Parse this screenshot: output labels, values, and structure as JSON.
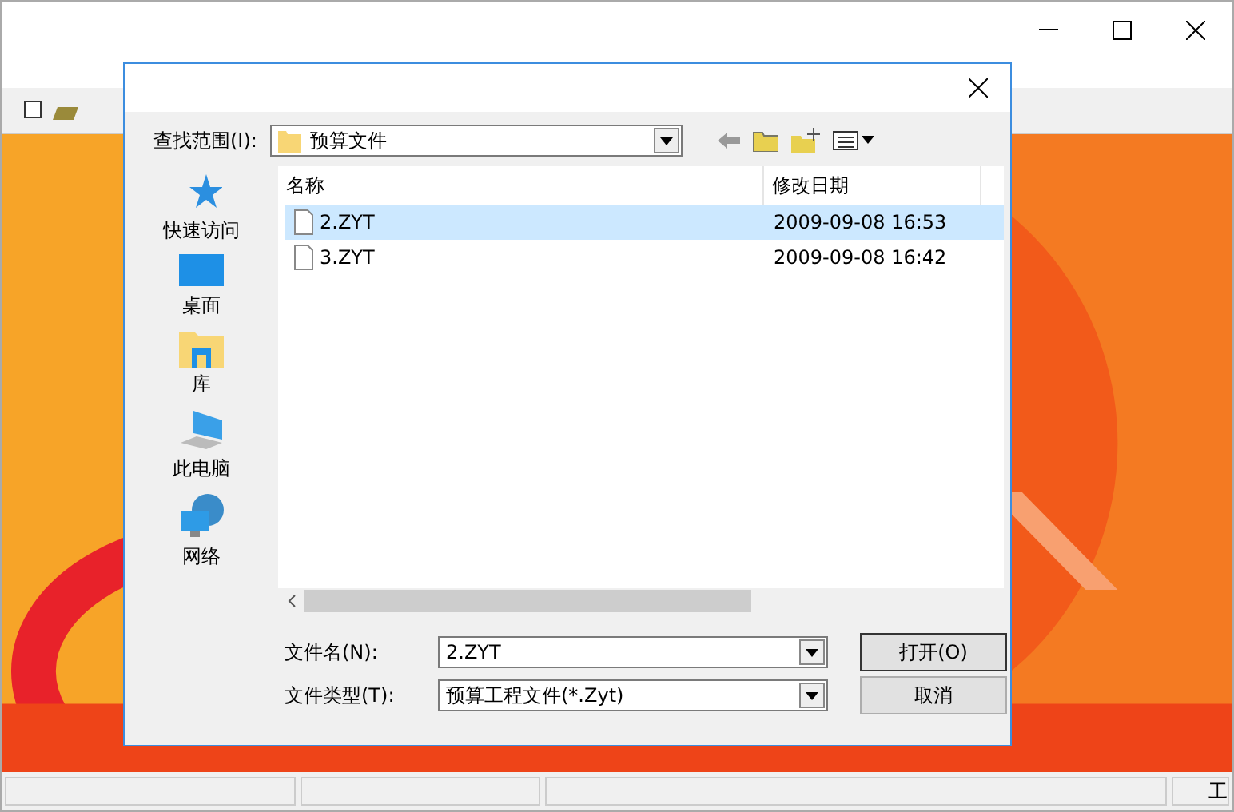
{
  "app_window": {
    "status_bar": [
      "工"
    ]
  },
  "dialog": {
    "look_in": {
      "label": "查找范围(I):",
      "value": "预算文件"
    },
    "places": [
      {
        "label": "快速访问",
        "kind": "star"
      },
      {
        "label": "桌面",
        "kind": "desktop"
      },
      {
        "label": "库",
        "kind": "library"
      },
      {
        "label": "此电脑",
        "kind": "computer"
      },
      {
        "label": "网络",
        "kind": "network"
      }
    ],
    "file_list": {
      "columns": [
        "名称",
        "修改日期"
      ],
      "rows": [
        {
          "name": "2.ZYT",
          "modified": "2009-09-08 16:53",
          "selected": true
        },
        {
          "name": "3.ZYT",
          "modified": "2009-09-08 16:42",
          "selected": false
        }
      ]
    },
    "file_name": {
      "label": "文件名(N):",
      "value": "2.ZYT"
    },
    "file_type": {
      "label": "文件类型(T):",
      "value": "预算工程文件(*.Zyt)"
    },
    "buttons": [
      "打开(O)",
      "取消"
    ]
  }
}
